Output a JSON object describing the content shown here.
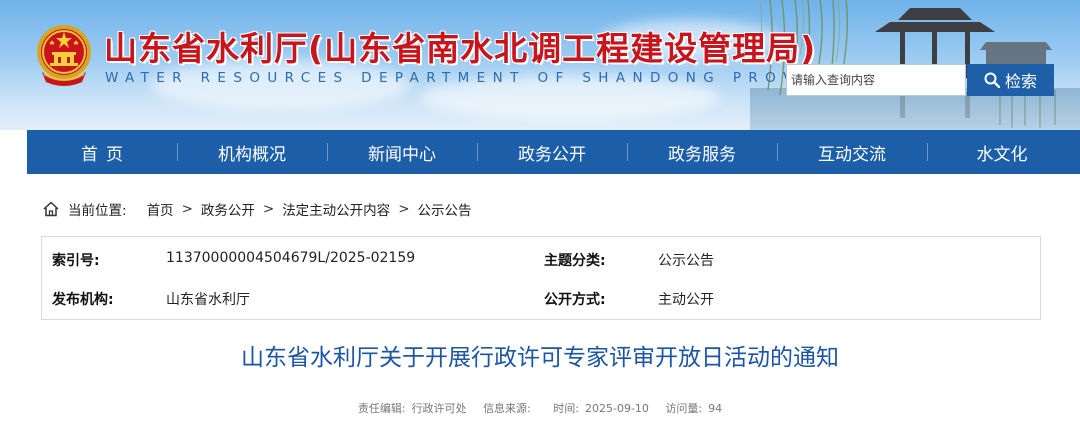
{
  "header": {
    "title": "山东省水利厅(山东省南水北调工程建设管理局)",
    "subtitle": "WATER RESOURCES DEPARTMENT OF SHANDONG PROVINCE",
    "search_placeholder": "请输入查询内容",
    "search_button": "检索"
  },
  "nav": {
    "items": [
      {
        "label": "首页"
      },
      {
        "label": "机构概况"
      },
      {
        "label": "新闻中心"
      },
      {
        "label": "政务公开"
      },
      {
        "label": "政务服务"
      },
      {
        "label": "互动交流"
      },
      {
        "label": "水文化"
      }
    ]
  },
  "breadcrumb": {
    "label": "当前位置:",
    "items": [
      "首页",
      "政务公开",
      "法定主动公开内容",
      "公示公告"
    ],
    "separator": ">"
  },
  "info": {
    "index_key": "索引号:",
    "index_value": "11370000004504679L/2025-02159",
    "category_key": "主题分类:",
    "category_value": "公示公告",
    "publisher_key": "发布机构:",
    "publisher_value": "山东省水利厅",
    "disclosure_key": "公开方式:",
    "disclosure_value": "主动公开"
  },
  "article": {
    "title": "山东省水利厅关于开展行政许可专家评审开放日活动的通知",
    "meta": {
      "editor_label": "责任编辑:",
      "editor_value": "行政许可处",
      "source_label": "信息来源:",
      "source_value": "",
      "time_label": "时间:",
      "time_value": "2025-09-10",
      "views_label": "访问量:",
      "views_value": "94"
    }
  },
  "colors": {
    "nav_bg": "#1d5ea8",
    "title_red": "#c8141b",
    "subtitle_blue": "#2d6cae",
    "article_title_blue": "#1c55a6",
    "search_button_bg": "#1f5fa8"
  },
  "icons": {
    "emblem": "national-emblem-icon",
    "search": "magnifier-icon",
    "home": "home-icon"
  }
}
